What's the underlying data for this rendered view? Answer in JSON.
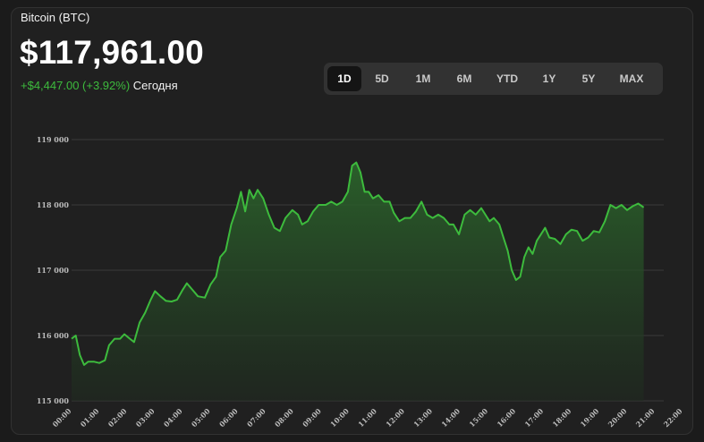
{
  "header": {
    "asset_name": "Bitcoin (BTC)",
    "price": "$117,961.00",
    "change": "+$4,447.00 (+3.92%)",
    "period_label": "Сегодня"
  },
  "ranges": [
    {
      "label": "1D",
      "active": true
    },
    {
      "label": "5D",
      "active": false
    },
    {
      "label": "1M",
      "active": false
    },
    {
      "label": "6M",
      "active": false
    },
    {
      "label": "YTD",
      "active": false
    },
    {
      "label": "1Y",
      "active": false
    },
    {
      "label": "5Y",
      "active": false
    },
    {
      "label": "MAX",
      "active": false
    }
  ],
  "colors": {
    "line": "#3dbb3d",
    "fill_top": "#2c6a2c",
    "fill_bottom": "#1f2a1f",
    "grid": "#3a3a3a",
    "positive": "#3dbb3d"
  },
  "chart_data": {
    "type": "area",
    "title": "",
    "xlabel": "",
    "ylabel": "",
    "ylim": [
      115000,
      119000
    ],
    "xlim": [
      0,
      23
    ],
    "grid": true,
    "y_ticks": [
      {
        "value": 119000,
        "label": "119 000"
      },
      {
        "value": 118000,
        "label": "118 000"
      },
      {
        "value": 117000,
        "label": "117 000"
      },
      {
        "value": 116000,
        "label": "116 000"
      },
      {
        "value": 115000,
        "label": "115 000"
      }
    ],
    "x_ticks": [
      {
        "value": 0,
        "label": "00:00"
      },
      {
        "value": 1,
        "label": "01:00"
      },
      {
        "value": 2,
        "label": "02:00"
      },
      {
        "value": 3,
        "label": "03:00"
      },
      {
        "value": 4,
        "label": "04:00"
      },
      {
        "value": 5,
        "label": "05:00"
      },
      {
        "value": 6,
        "label": "06:00"
      },
      {
        "value": 7,
        "label": "07:00"
      },
      {
        "value": 8,
        "label": "08:00"
      },
      {
        "value": 9,
        "label": "09:00"
      },
      {
        "value": 10,
        "label": "10:00"
      },
      {
        "value": 11,
        "label": "11:00"
      },
      {
        "value": 12,
        "label": "12:00"
      },
      {
        "value": 13,
        "label": "13:00"
      },
      {
        "value": 14,
        "label": "14:00"
      },
      {
        "value": 15,
        "label": "15:00"
      },
      {
        "value": 16,
        "label": "16:00"
      },
      {
        "value": 17,
        "label": "17:00"
      },
      {
        "value": 18,
        "label": "18:00"
      },
      {
        "value": 19,
        "label": "19:00"
      },
      {
        "value": 20,
        "label": "20:00"
      },
      {
        "value": 21,
        "label": "21:00"
      },
      {
        "value": 22,
        "label": "22:00"
      }
    ],
    "series": [
      {
        "values": [
          {
            "x": 0.0,
            "y": 115950
          },
          {
            "x": 0.15,
            "y": 116000
          },
          {
            "x": 0.3,
            "y": 115700
          },
          {
            "x": 0.45,
            "y": 115550
          },
          {
            "x": 0.6,
            "y": 115600
          },
          {
            "x": 0.8,
            "y": 115600
          },
          {
            "x": 1.0,
            "y": 115580
          },
          {
            "x": 1.2,
            "y": 115620
          },
          {
            "x": 1.35,
            "y": 115850
          },
          {
            "x": 1.55,
            "y": 115950
          },
          {
            "x": 1.75,
            "y": 115950
          },
          {
            "x": 1.9,
            "y": 116020
          },
          {
            "x": 2.1,
            "y": 115950
          },
          {
            "x": 2.25,
            "y": 115900
          },
          {
            "x": 2.45,
            "y": 116200
          },
          {
            "x": 2.65,
            "y": 116350
          },
          {
            "x": 2.85,
            "y": 116550
          },
          {
            "x": 3.0,
            "y": 116680
          },
          {
            "x": 3.2,
            "y": 116600
          },
          {
            "x": 3.4,
            "y": 116530
          },
          {
            "x": 3.6,
            "y": 116520
          },
          {
            "x": 3.8,
            "y": 116550
          },
          {
            "x": 4.0,
            "y": 116700
          },
          {
            "x": 4.15,
            "y": 116800
          },
          {
            "x": 4.35,
            "y": 116700
          },
          {
            "x": 4.55,
            "y": 116600
          },
          {
            "x": 4.8,
            "y": 116580
          },
          {
            "x": 5.0,
            "y": 116780
          },
          {
            "x": 5.2,
            "y": 116900
          },
          {
            "x": 5.35,
            "y": 117200
          },
          {
            "x": 5.55,
            "y": 117300
          },
          {
            "x": 5.75,
            "y": 117700
          },
          {
            "x": 5.95,
            "y": 117950
          },
          {
            "x": 6.1,
            "y": 118200
          },
          {
            "x": 6.25,
            "y": 117900
          },
          {
            "x": 6.4,
            "y": 118230
          },
          {
            "x": 6.55,
            "y": 118100
          },
          {
            "x": 6.7,
            "y": 118230
          },
          {
            "x": 6.9,
            "y": 118100
          },
          {
            "x": 7.1,
            "y": 117850
          },
          {
            "x": 7.3,
            "y": 117650
          },
          {
            "x": 7.5,
            "y": 117600
          },
          {
            "x": 7.7,
            "y": 117800
          },
          {
            "x": 7.95,
            "y": 117920
          },
          {
            "x": 8.15,
            "y": 117850
          },
          {
            "x": 8.3,
            "y": 117700
          },
          {
            "x": 8.5,
            "y": 117750
          },
          {
            "x": 8.7,
            "y": 117900
          },
          {
            "x": 8.9,
            "y": 118000
          },
          {
            "x": 9.15,
            "y": 118000
          },
          {
            "x": 9.35,
            "y": 118050
          },
          {
            "x": 9.55,
            "y": 118000
          },
          {
            "x": 9.75,
            "y": 118050
          },
          {
            "x": 9.95,
            "y": 118200
          },
          {
            "x": 10.1,
            "y": 118600
          },
          {
            "x": 10.25,
            "y": 118650
          },
          {
            "x": 10.4,
            "y": 118500
          },
          {
            "x": 10.55,
            "y": 118200
          },
          {
            "x": 10.7,
            "y": 118200
          },
          {
            "x": 10.85,
            "y": 118100
          },
          {
            "x": 11.05,
            "y": 118150
          },
          {
            "x": 11.25,
            "y": 118050
          },
          {
            "x": 11.45,
            "y": 118050
          },
          {
            "x": 11.6,
            "y": 117880
          },
          {
            "x": 11.8,
            "y": 117750
          },
          {
            "x": 12.0,
            "y": 117800
          },
          {
            "x": 12.2,
            "y": 117800
          },
          {
            "x": 12.4,
            "y": 117900
          },
          {
            "x": 12.6,
            "y": 118050
          },
          {
            "x": 12.8,
            "y": 117850
          },
          {
            "x": 13.0,
            "y": 117800
          },
          {
            "x": 13.2,
            "y": 117850
          },
          {
            "x": 13.4,
            "y": 117800
          },
          {
            "x": 13.6,
            "y": 117700
          },
          {
            "x": 13.75,
            "y": 117700
          },
          {
            "x": 13.95,
            "y": 117550
          },
          {
            "x": 14.15,
            "y": 117850
          },
          {
            "x": 14.35,
            "y": 117920
          },
          {
            "x": 14.55,
            "y": 117850
          },
          {
            "x": 14.75,
            "y": 117950
          },
          {
            "x": 14.9,
            "y": 117850
          },
          {
            "x": 15.05,
            "y": 117750
          },
          {
            "x": 15.2,
            "y": 117800
          },
          {
            "x": 15.4,
            "y": 117700
          },
          {
            "x": 15.55,
            "y": 117500
          },
          {
            "x": 15.7,
            "y": 117300
          },
          {
            "x": 15.85,
            "y": 117000
          },
          {
            "x": 16.0,
            "y": 116850
          },
          {
            "x": 16.15,
            "y": 116900
          },
          {
            "x": 16.3,
            "y": 117200
          },
          {
            "x": 16.45,
            "y": 117350
          },
          {
            "x": 16.6,
            "y": 117250
          },
          {
            "x": 16.75,
            "y": 117450
          },
          {
            "x": 16.9,
            "y": 117550
          },
          {
            "x": 17.05,
            "y": 117650
          },
          {
            "x": 17.2,
            "y": 117500
          },
          {
            "x": 17.4,
            "y": 117480
          },
          {
            "x": 17.6,
            "y": 117400
          },
          {
            "x": 17.8,
            "y": 117550
          },
          {
            "x": 18.0,
            "y": 117620
          },
          {
            "x": 18.2,
            "y": 117600
          },
          {
            "x": 18.4,
            "y": 117450
          },
          {
            "x": 18.6,
            "y": 117500
          },
          {
            "x": 18.8,
            "y": 117600
          },
          {
            "x": 19.0,
            "y": 117580
          },
          {
            "x": 19.2,
            "y": 117750
          },
          {
            "x": 19.4,
            "y": 118000
          },
          {
            "x": 19.6,
            "y": 117950
          },
          {
            "x": 19.8,
            "y": 118000
          },
          {
            "x": 20.0,
            "y": 117920
          },
          {
            "x": 20.2,
            "y": 117980
          },
          {
            "x": 20.4,
            "y": 118020
          },
          {
            "x": 20.6,
            "y": 117961
          }
        ]
      }
    ]
  }
}
